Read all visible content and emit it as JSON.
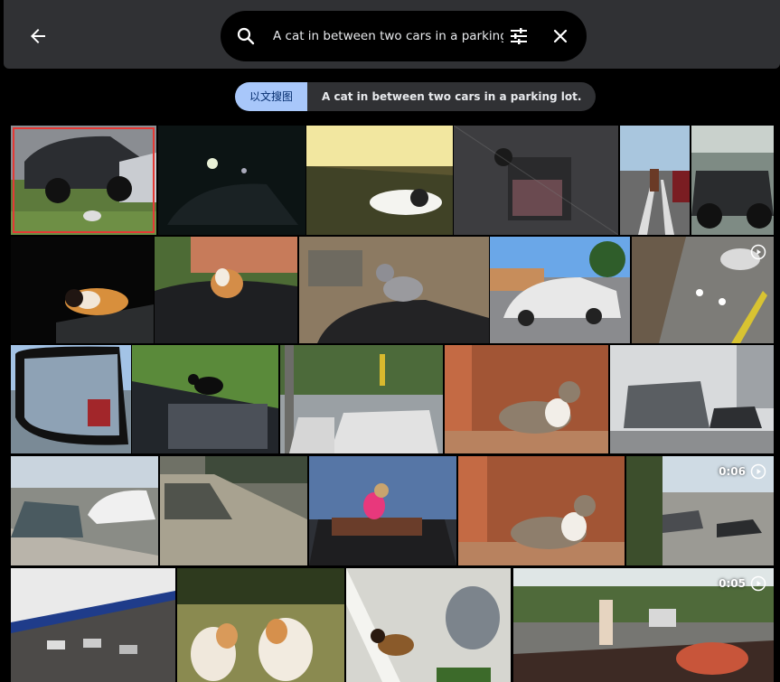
{
  "header": {
    "back_label": "Back",
    "search_value": "A cat in between two cars in a parking lot.",
    "search_placeholder": "Search"
  },
  "chips": {
    "lens_label": "以文搜图",
    "query_label": "A cat in between two cars in a parking lot."
  },
  "results": [
    {
      "row": 1,
      "desc": "cat between cars",
      "selected": true
    },
    {
      "row": 1,
      "desc": "night parking lot"
    },
    {
      "row": 1,
      "desc": "cat lying on dashboard"
    },
    {
      "row": 1,
      "desc": "car interior with cat"
    },
    {
      "row": 1,
      "desc": "dog walking in lot"
    },
    {
      "row": 1,
      "desc": "jeep"
    },
    {
      "row": 2,
      "desc": "calico cat on car at night"
    },
    {
      "row": 2,
      "desc": "calico cat on mercedes hood"
    },
    {
      "row": 2,
      "desc": "tabby cat on car hood in garage"
    },
    {
      "row": 2,
      "desc": "white sedan parked"
    },
    {
      "row": 2,
      "desc": "overhead parking camera",
      "video": true,
      "duration": ""
    },
    {
      "row": 3,
      "desc": "side mirror reflection"
    },
    {
      "row": 3,
      "desc": "black cat on engine"
    },
    {
      "row": 3,
      "desc": "street with traffic lights"
    },
    {
      "row": 3,
      "desc": "tabby cat on brick ledge"
    },
    {
      "row": 3,
      "desc": "van parked outside building"
    },
    {
      "row": 4,
      "desc": "parking lot with pickup"
    },
    {
      "row": 4,
      "desc": "silver pickup truck"
    },
    {
      "row": 4,
      "desc": "dog on convertible"
    },
    {
      "row": 4,
      "desc": "tabby cat on ledge"
    },
    {
      "row": 4,
      "desc": "street camera",
      "video": true,
      "duration": "0:06"
    },
    {
      "row": 5,
      "desc": "parked cars beside building"
    },
    {
      "row": 5,
      "desc": "two cats on deck"
    },
    {
      "row": 5,
      "desc": "cat and dog on porch"
    },
    {
      "row": 5,
      "desc": "man outdoors",
      "video": true,
      "duration": "0:05"
    }
  ],
  "colors": {
    "chip_lens": "#a8c7fa",
    "topbar": "#303134",
    "selection": "#e53935"
  }
}
